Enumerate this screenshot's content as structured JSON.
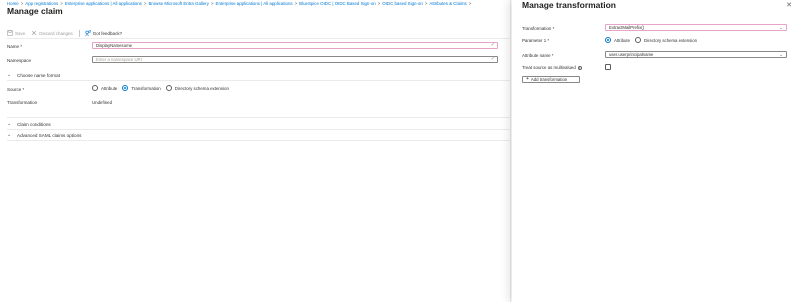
{
  "breadcrumb": [
    "Home",
    "App registrations",
    "Enterprise applications | All applications",
    "Browse Microsoft Entra Gallery",
    "Enterprise applications | All applications",
    "BlueSpice OIDC | OIDC Based Sign-on",
    "OIDC based Sign-on",
    "Attributes & Claims"
  ],
  "breadcrumb_sep": ">",
  "page_title": "Manage claim",
  "toolbar": {
    "save": "Save",
    "discard": "Discard changes",
    "feedback": "Got feedback?"
  },
  "form": {
    "name_label": "Name *",
    "name_value": "DisplayNamesome",
    "namespace_label": "Namespace",
    "namespace_placeholder": "Enter a namespace URI",
    "choose_format": "Choose name format",
    "source_label": "Source *",
    "source_options": [
      "Attribute",
      "Transformation",
      "Directory schema extension"
    ],
    "source_selected": "Transformation",
    "transformation_label": "Transformation",
    "transformation_value": "Undefined",
    "claim_conditions": "Claim conditions",
    "advanced_saml": "Advanced SAML claims options"
  },
  "panel": {
    "title": "Manage transformation",
    "transformation_label": "Transformation *",
    "transformation_value": "ExtractMailPrefix()",
    "parameter_label": "Parameter 1 *",
    "parameter_options": [
      "Attribute",
      "Directory schema extension"
    ],
    "parameter_selected": "Attribute",
    "attribute_name_label": "Attribute name *",
    "attribute_name_value": "user.userprincipalname",
    "treat_multivalued_label": "Treat source as multivalued",
    "add_transformation": "Add transformation"
  },
  "colors": {
    "link": "#0078d4",
    "required_border": "#e8a3c8"
  }
}
